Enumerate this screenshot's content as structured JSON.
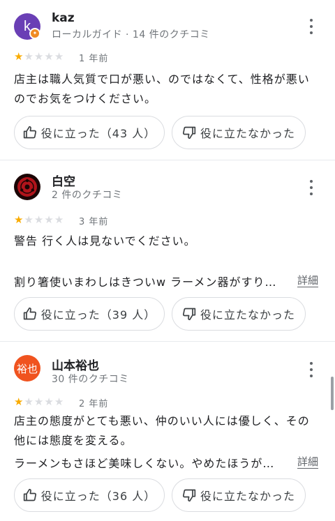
{
  "reviews": [
    {
      "avatar_letter": "k",
      "name": "kaz",
      "meta": "ローカルガイド · 14 件のクチコミ",
      "rating": 1,
      "date": "1 年前",
      "text_lines": [
        "店主は職人気質で口が悪い、のではなくて、性格が悪い",
        "のでお気をつけください。"
      ],
      "helpful_label": "役に立った（43 人）",
      "not_helpful_label": "役に立たなかった"
    },
    {
      "name": "白空",
      "meta": "2 件のクチコミ",
      "rating": 1,
      "date": "3 年前",
      "text_lines": [
        "警告 行く人は見ないでください。",
        "割り箸使いまわしはきついw ラーメン器がすり…"
      ],
      "more_label": "詳細",
      "helpful_label": "役に立った（39 人）",
      "not_helpful_label": "役に立たなかった"
    },
    {
      "avatar_text": "裕也",
      "name": "山本裕也",
      "meta": "30 件のクチコミ",
      "rating": 1,
      "date": "2 年前",
      "text_lines": [
        "店主の態度がとても悪い、仲のいい人には優しく、その",
        "他には態度を変える。",
        "ラーメンもさほど美味しくない。やめたほうが…"
      ],
      "more_label": "詳細",
      "helpful_label": "役に立った（36 人）",
      "not_helpful_label": "役に立たなかった"
    }
  ],
  "colors": {
    "star_on": "#f9ab00",
    "star_off": "#dadce0",
    "avatar_kaz": "#6a3fb5",
    "avatar_yuya": "#f0531f",
    "badge": "#f08a24"
  },
  "icons": {
    "helpful": "thumb-up-icon",
    "not_helpful": "thumb-down-icon",
    "menu": "more-vert-icon",
    "badge": "local-guide-badge-icon"
  }
}
